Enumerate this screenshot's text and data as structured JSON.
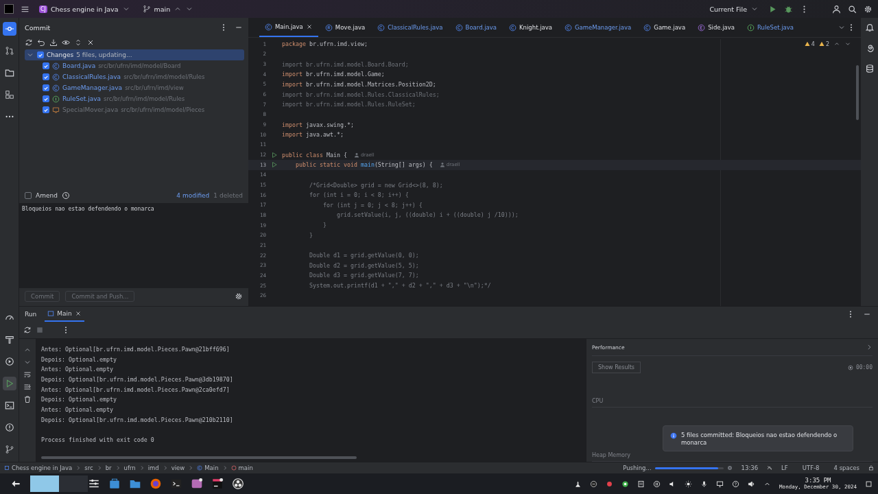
{
  "window": {
    "project_badge": "CJ",
    "project": "Chess engine in Java",
    "branch": "main",
    "run_config": "Current File"
  },
  "commit_panel": {
    "title": "Commit",
    "changes": {
      "label": "Changes",
      "summary": "5 files, updating...",
      "checked": true,
      "expanded": true,
      "selected": true,
      "children": [
        {
          "name": "Board.java",
          "path": "src/br/ufrn/imd/model/Board",
          "kind": "class",
          "deleted": false,
          "checked": true
        },
        {
          "name": "ClassicalRules.java",
          "path": "src/br/ufrn/imd/model/Rules",
          "kind": "class",
          "deleted": false,
          "checked": true
        },
        {
          "name": "GameManager.java",
          "path": "src/br/ufrn/imd/view",
          "kind": "class",
          "deleted": false,
          "checked": true
        },
        {
          "name": "RuleSet.java",
          "path": "src/br/ufrn/imd/model/Rules",
          "kind": "interface",
          "deleted": false,
          "checked": true
        },
        {
          "name": "SpecialMover.java",
          "path": "src/br/ufrn/imd/model/Pieces",
          "kind": "deleted",
          "deleted": true,
          "checked": true
        }
      ]
    },
    "amend": {
      "label": "Amend",
      "checked": false
    },
    "modified": "4 modified",
    "deleted": "1 deleted",
    "message": "Bloqueios nao estao defendendo o monarca",
    "buttons": [
      {
        "label": "Commit",
        "disabled": true
      },
      {
        "label": "Commit and Push...",
        "disabled": true
      }
    ]
  },
  "editor": {
    "tabs": [
      {
        "label": "Main.java",
        "kind": "class",
        "modified": false,
        "selected": true
      },
      {
        "label": "Move.java",
        "kind": "record",
        "modified": false,
        "selected": false
      },
      {
        "label": "ClassicalRules.java",
        "kind": "class",
        "modified": true,
        "selected": false
      },
      {
        "label": "Board.java",
        "kind": "class",
        "modified": true,
        "selected": false
      },
      {
        "label": "Knight.java",
        "kind": "class",
        "modified": false,
        "selected": false
      },
      {
        "label": "GameManager.java",
        "kind": "class",
        "modified": true,
        "selected": false
      },
      {
        "label": "Game.java",
        "kind": "class",
        "modified": false,
        "selected": false
      },
      {
        "label": "Side.java",
        "kind": "enum",
        "modified": false,
        "selected": false
      },
      {
        "label": "RuleSet.java",
        "kind": "interface",
        "modified": true,
        "selected": false
      }
    ],
    "warnings": "4",
    "weak_warnings": "2",
    "lines": [
      {
        "number": "1",
        "segments": [
          {
            "text": "package ",
            "kind": "kw"
          },
          {
            "text": "br.ufrn.imd.view;",
            "kind": "plain"
          }
        ]
      },
      {
        "number": "2"
      },
      {
        "number": "3",
        "segments": [
          {
            "text": "import br.ufrn.imd.model.Board.Board;",
            "kind": "dim"
          }
        ]
      },
      {
        "number": "4",
        "segments": [
          {
            "text": "import ",
            "kind": "kw"
          },
          {
            "text": "br.ufrn.imd.model.Game;",
            "kind": "plain"
          }
        ]
      },
      {
        "number": "5",
        "segments": [
          {
            "text": "import ",
            "kind": "kw"
          },
          {
            "text": "br.ufrn.imd.model.Matrices.Position2D;",
            "kind": "plain"
          }
        ]
      },
      {
        "number": "6",
        "segments": [
          {
            "text": "import br.ufrn.imd.model.Rules.ClassicalRules;",
            "kind": "dim"
          }
        ]
      },
      {
        "number": "7",
        "segments": [
          {
            "text": "import br.ufrn.imd.model.Rules.RuleSet;",
            "kind": "dim"
          }
        ]
      },
      {
        "number": "8"
      },
      {
        "number": "9",
        "segments": [
          {
            "text": "import ",
            "kind": "kw"
          },
          {
            "text": "javax.swing.*;",
            "kind": "plain"
          }
        ]
      },
      {
        "number": "10",
        "segments": [
          {
            "text": "import ",
            "kind": "kw"
          },
          {
            "text": "java.awt.*;",
            "kind": "plain"
          }
        ]
      },
      {
        "number": "11"
      },
      {
        "number": "12",
        "run": true,
        "author": "draell",
        "segments": [
          {
            "text": "public class ",
            "kind": "kw"
          },
          {
            "text": "Main {",
            "kind": "plain"
          }
        ]
      },
      {
        "number": "13",
        "run": true,
        "current": true,
        "author": "draell",
        "segments": [
          {
            "text": "    public static void ",
            "kind": "kw"
          },
          {
            "text": "main",
            "kind": "fn"
          },
          {
            "text": "(String[] args) {",
            "kind": "plain"
          }
        ]
      },
      {
        "number": "14"
      },
      {
        "number": "15",
        "segments": [
          {
            "text": "        /*Grid<Double> grid = new Grid<>(8, 8);",
            "kind": "comment"
          }
        ]
      },
      {
        "number": "16",
        "segments": [
          {
            "text": "        for (int i = 0; i < 8; i++) {",
            "kind": "comment"
          }
        ]
      },
      {
        "number": "17",
        "segments": [
          {
            "text": "            for (int j = 0; j < 8; j++) {",
            "kind": "comment"
          }
        ]
      },
      {
        "number": "18",
        "segments": [
          {
            "text": "                grid.setValue(i, j, ((double) i + ((double) j /10)));",
            "kind": "comment"
          }
        ]
      },
      {
        "number": "19",
        "segments": [
          {
            "text": "            }",
            "kind": "comment"
          }
        ]
      },
      {
        "number": "20",
        "segments": [
          {
            "text": "        }",
            "kind": "comment"
          }
        ]
      },
      {
        "number": "21"
      },
      {
        "number": "22",
        "segments": [
          {
            "text": "        Double d1 = grid.getValue(0, 0);",
            "kind": "comment"
          }
        ]
      },
      {
        "number": "23",
        "segments": [
          {
            "text": "        Double d2 = grid.getValue(5, 5);",
            "kind": "comment"
          }
        ]
      },
      {
        "number": "24",
        "segments": [
          {
            "text": "        Double d3 = grid.getValue(7, 7);",
            "kind": "comment"
          }
        ]
      },
      {
        "number": "25",
        "segments": [
          {
            "text": "        System.out.printf(d1 + \",\" + d2 + \",\" + d3 + \"\\n\");*/",
            "kind": "comment"
          }
        ]
      },
      {
        "number": "26"
      }
    ]
  },
  "run_panel": {
    "title": "Run",
    "tabs": [
      {
        "label": "Main",
        "selected": true
      }
    ],
    "output": [
      "Antes: Optional[br.ufrn.imd.model.Pieces.Pawn@21bff696]",
      "Depois: Optional.empty",
      "Antes: Optional.empty",
      "Depois: Optional[br.ufrn.imd.model.Pieces.Pawn@3db19870]",
      "Antes: Optional[br.ufrn.imd.model.Pieces.Pawn@2ca0efd7]",
      "Depois: Optional.empty",
      "Antes: Optional.empty",
      "Depois: Optional[br.ufrn.imd.model.Pieces.Pawn@210b2110]"
    ],
    "exit_message": "Process finished with exit code 0",
    "performance": {
      "title": "Performance",
      "show_results": "Show Results",
      "timer": "00:00",
      "cpu": "CPU",
      "heap": "Heap Memory"
    }
  },
  "notification": {
    "text": "5 files committed: Bloqueios nao estao defendendo o monarca"
  },
  "status_bar": {
    "breadcrumbs": [
      {
        "label": "Chess engine in Java",
        "kind": "module"
      },
      {
        "label": "src",
        "kind": "folder"
      },
      {
        "label": "br",
        "kind": "folder"
      },
      {
        "label": "ufrn",
        "kind": "folder"
      },
      {
        "label": "imd",
        "kind": "folder"
      },
      {
        "label": "view",
        "kind": "folder"
      },
      {
        "label": "Main",
        "kind": "class"
      },
      {
        "label": "main",
        "kind": "method"
      }
    ],
    "task": "Pushing...",
    "level": 0.92,
    "position": "13:36",
    "line_ending": "LF",
    "encoding": "UTF-8",
    "indent": "4 spaces"
  },
  "taskbar": {
    "time": "3:35 PM",
    "date": "Monday, December 30, 2024"
  }
}
